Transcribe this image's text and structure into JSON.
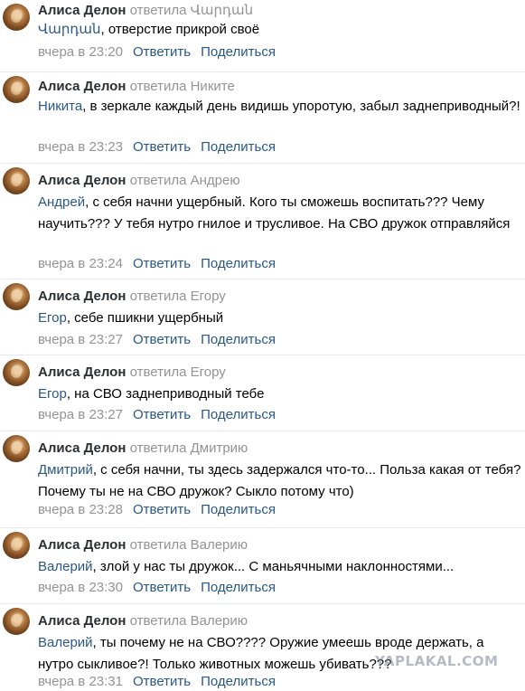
{
  "comments": [
    {
      "author": "Алиса Делон",
      "replied": "ответила Վարդան",
      "addressee": "Վարդան",
      "text": ", отверстие прикрой своё",
      "time": "вчера в 23:20"
    },
    {
      "author": "Алиса Делон",
      "replied": "ответила Никите",
      "addressee": "Никита",
      "text": ", в зеркале каждый день видишь упоротую, забыл заднеприводный?!",
      "time": "вчера в 23:23"
    },
    {
      "author": "Алиса Делон",
      "replied": "ответила Андрею",
      "addressee": "Андрей",
      "text": ", с себя начни ущербный. Кого ты сможешь воспитать??? Чему научить??? У тебя нутро гнилое и трусливое. На СВО дружок отправляйся",
      "time": "вчера в 23:24"
    },
    {
      "author": "Алиса Делон",
      "replied": "ответила Егору",
      "addressee": "Егор",
      "text": ", себе пшикни ущербный",
      "time": "вчера в 23:27"
    },
    {
      "author": "Алиса Делон",
      "replied": "ответила Егору",
      "addressee": "Егор",
      "text": ", на СВО заднеприводный тебе",
      "time": "вчера в 23:27"
    },
    {
      "author": "Алиса Делон",
      "replied": "ответила Дмитрию",
      "addressee": "Дмитрий",
      "text": ", с себя начни, ты здесь задержался что-то... Польза какая от тебя? Почему ты не на СВО дружок? Сыкло потому что)",
      "time": "вчера в 23:28"
    },
    {
      "author": "Алиса Делон",
      "replied": "ответила Валерию",
      "addressee": "Валерий",
      "text": ", злой у нас ты дружок... С маньячными наклонностями...",
      "time": "вчера в 23:30"
    },
    {
      "author": "Алиса Делон",
      "replied": "ответила Валерию",
      "addressee": "Валерий",
      "text": ", ты почему не на СВО???? Оружие умеешь вроде держать, а нутро сыкливое?! Только животных можешь убивать???",
      "time": "вчера в 23:31"
    }
  ],
  "actions": {
    "reply": "Ответить",
    "share": "Поделиться"
  },
  "watermark": "YAPLAKAL.COM",
  "colors": {
    "link": "#2a5885",
    "muted": "#939393",
    "author": "#2b2f33",
    "divider": "#e7e8ec"
  }
}
